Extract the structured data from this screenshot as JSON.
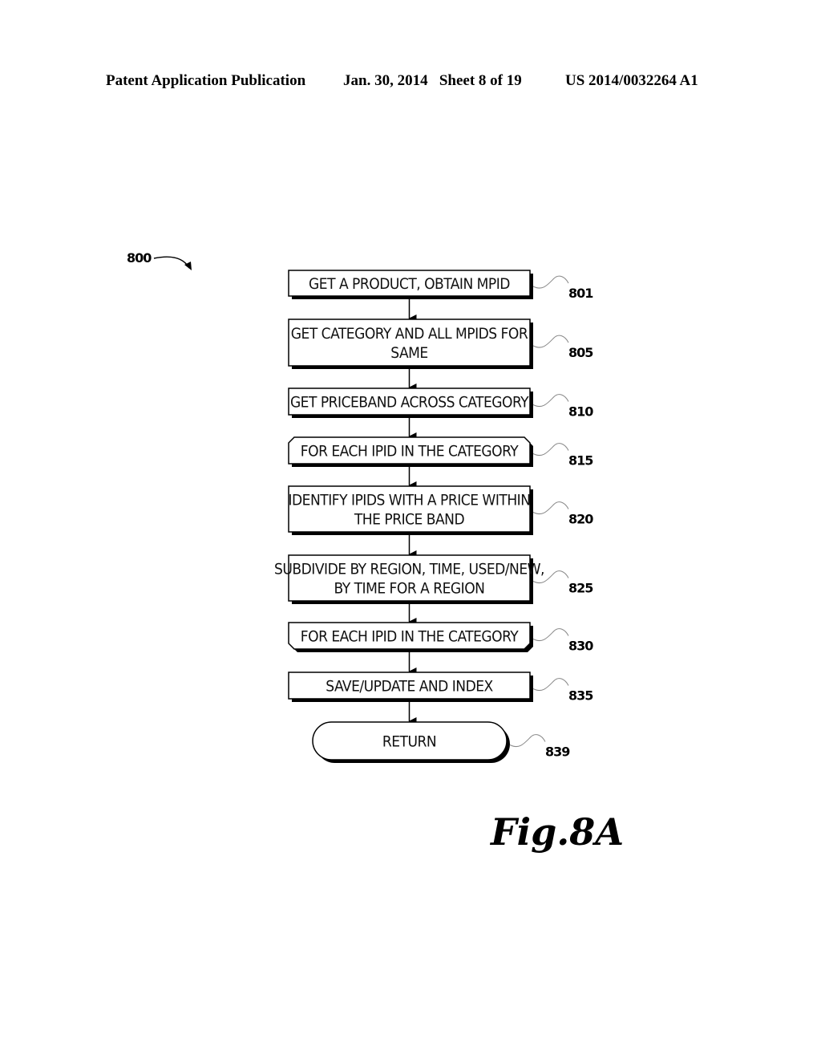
{
  "header": {
    "publication": "Patent Application Publication",
    "date_sheet": "Jan. 30, 2014   Sheet 8 of 19",
    "number": "US 2014/0032264 A1"
  },
  "figure": {
    "ref": "800",
    "label": "Fig.8A"
  },
  "steps": [
    {
      "id": "801",
      "shape": "process",
      "lines": [
        "GET A PRODUCT, OBTAIN MPID"
      ]
    },
    {
      "id": "805",
      "shape": "process",
      "lines": [
        "GET CATEGORY AND ALL MPIDS FOR",
        "SAME"
      ]
    },
    {
      "id": "810",
      "shape": "process",
      "lines": [
        "GET PRICEBAND ACROSS CATEGORY"
      ]
    },
    {
      "id": "815",
      "shape": "loop-start",
      "lines": [
        "FOR EACH IPID IN THE CATEGORY"
      ]
    },
    {
      "id": "820",
      "shape": "process",
      "lines": [
        "IDENTIFY IPIDS WITH A PRICE WITHIN",
        "THE PRICE BAND"
      ]
    },
    {
      "id": "825",
      "shape": "process",
      "lines": [
        "SUBDIVIDE BY REGION, TIME, USED/NEW,",
        "BY TIME FOR A REGION"
      ]
    },
    {
      "id": "830",
      "shape": "loop-end",
      "lines": [
        "FOR EACH IPID IN THE CATEGORY"
      ]
    },
    {
      "id": "835",
      "shape": "process",
      "lines": [
        "SAVE/UPDATE AND INDEX"
      ]
    },
    {
      "id": "839",
      "shape": "terminator",
      "lines": [
        "RETURN"
      ]
    }
  ]
}
